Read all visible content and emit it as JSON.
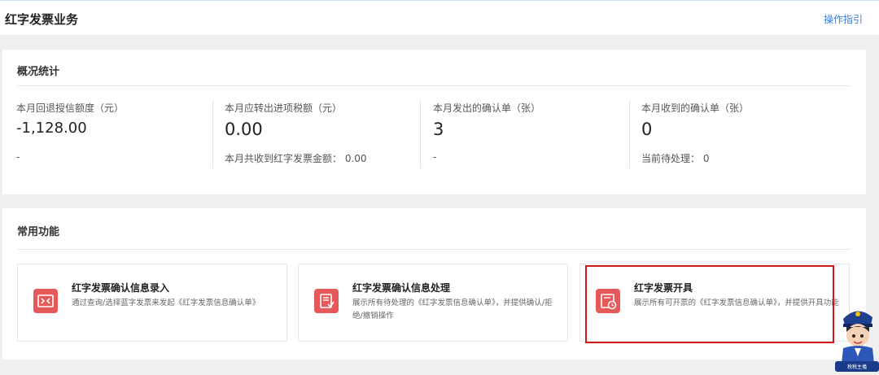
{
  "header": {
    "title": "红字发票业务",
    "guide_link": "操作指引"
  },
  "overview": {
    "title": "概况统计",
    "stats": [
      {
        "label": "本月回退授信额度（元）",
        "value": "-1,128.00",
        "sub": "-"
      },
      {
        "label": "本月应转出进项税额（元）",
        "value": "0.00",
        "sub": "本月共收到红字发票金额：  0.00"
      },
      {
        "label": "本月发出的确认单（张）",
        "value": "3",
        "sub": "-"
      },
      {
        "label": "本月收到的确认单（张）",
        "value": "0",
        "sub": "当前待处理：  0"
      }
    ]
  },
  "functions": {
    "title": "常用功能",
    "cards": [
      {
        "title": "红字发票确认信息录入",
        "desc": "通过查询/选择蓝字发票来发起《红字发票信息确认单》",
        "icon": "document-exchange-icon"
      },
      {
        "title": "红字发票确认信息处理",
        "desc": "展示所有待处理的《红字发票信息确认单》，并提供确认/拒绝/撤销操作",
        "icon": "document-process-icon"
      },
      {
        "title": "红字发票开具",
        "desc": "展示所有可开票的《红字发票信息确认单》，并提供开具功能",
        "icon": "document-clock-icon"
      }
    ]
  },
  "colors": {
    "accent_red": "#e6595b",
    "highlight": "#d0191c",
    "link": "#3b7ddd"
  },
  "mascot": {
    "caption": "税税主播"
  }
}
